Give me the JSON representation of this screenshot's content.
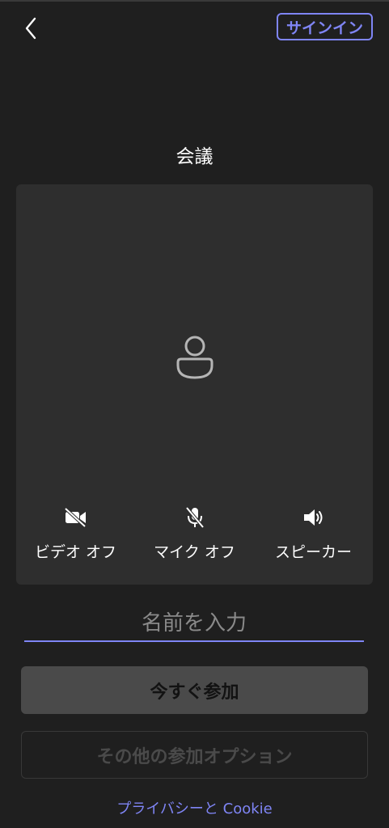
{
  "header": {
    "back_icon": "chevron-left-icon",
    "signin_label": "サインイン",
    "accent_color": "#7f85f5"
  },
  "meeting": {
    "title": "会議",
    "avatar_icon": "person-icon"
  },
  "controls": [
    {
      "icon": "video-off-icon",
      "label": "ビデオ オフ"
    },
    {
      "icon": "mic-off-icon",
      "label": "マイク オフ"
    },
    {
      "icon": "speaker-icon",
      "label": "スピーカー"
    }
  ],
  "name_input": {
    "value": "",
    "placeholder": "名前を入力"
  },
  "actions": {
    "join_label": "今すぐ参加",
    "options_label": "その他の参加オプション"
  },
  "footer": {
    "privacy_label": "プライバシーと Cookie"
  }
}
